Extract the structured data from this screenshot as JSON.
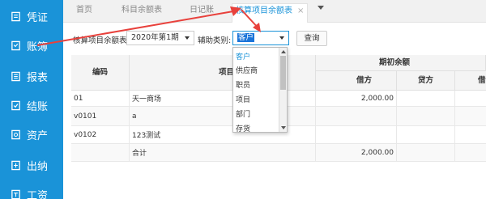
{
  "sidebar": {
    "items": [
      {
        "label": "凭证",
        "icon": "voucher-icon"
      },
      {
        "label": "账簿",
        "icon": "ledger-icon"
      },
      {
        "label": "报表",
        "icon": "report-icon"
      },
      {
        "label": "结账",
        "icon": "checkout-icon"
      },
      {
        "label": "资产",
        "icon": "asset-icon"
      },
      {
        "label": "出纳",
        "icon": "cashier-icon"
      },
      {
        "label": "工资",
        "icon": "salary-icon"
      }
    ],
    "bg_color": "#1a93d8"
  },
  "tabs": [
    {
      "label": "首页"
    },
    {
      "label": "科目余额表"
    },
    {
      "label": "日记账"
    },
    {
      "label": "核算项目余额表",
      "close": "×"
    }
  ],
  "filter": {
    "table_label": "核算项目余额表",
    "period_value": "2020年第1期",
    "aux_label": "辅助类别:",
    "aux_value": "客户",
    "query_label": "查询"
  },
  "dropdown": {
    "options": [
      "客户",
      "供应商",
      "职员",
      "项目",
      "部门",
      "存货"
    ],
    "selected": "客户"
  },
  "table": {
    "headers": {
      "code": "编码",
      "item": "项目",
      "opening_group": "期初余额",
      "debit": "借方",
      "credit": "贷方",
      "debit2": "借方"
    },
    "rows": [
      {
        "code": "01",
        "name": "天一商场",
        "debit": "2,000.00",
        "credit": "",
        "debit2": ""
      },
      {
        "code": "v0101",
        "name": "a",
        "debit": "",
        "credit": "",
        "debit2": ""
      },
      {
        "code": "v0102",
        "name": "123测试",
        "debit": "",
        "credit": "",
        "debit2": ""
      },
      {
        "code": "",
        "name": "合计",
        "debit": "2,000.00",
        "credit": "",
        "debit2": ""
      }
    ]
  },
  "accent_color": "#e8413c"
}
